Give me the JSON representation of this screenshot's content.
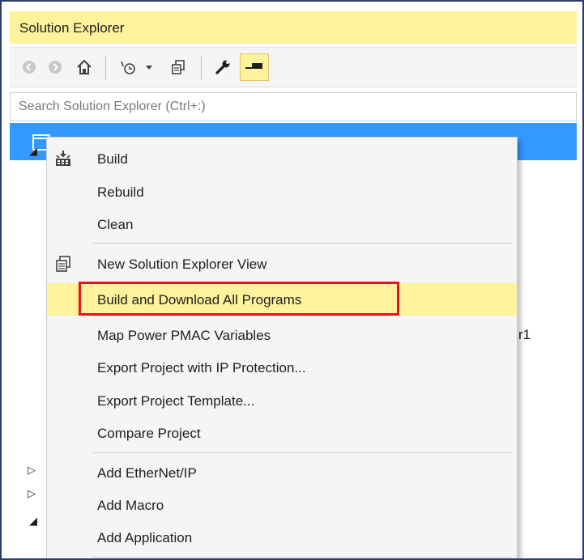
{
  "window": {
    "title": "Solution Explorer"
  },
  "search": {
    "placeholder": "Search Solution Explorer (Ctrl+:)"
  },
  "toolbar": {
    "icons": [
      "back-icon",
      "forward-icon",
      "home-icon",
      "pending-changes-icon",
      "dropdown-arrow-icon",
      "new-view-icon",
      "properties-wrench-icon",
      "pin-icon"
    ]
  },
  "tree": {
    "partial_text": "r1"
  },
  "context_menu": {
    "items": [
      {
        "label": "Build",
        "icon": "build-icon"
      },
      {
        "label": "Rebuild"
      },
      {
        "label": "Clean"
      },
      {
        "label": "New Solution Explorer View",
        "icon": "new-view-icon"
      },
      {
        "label": "Build and Download All Programs",
        "highlighted": true
      },
      {
        "label": "Map Power PMAC Variables"
      },
      {
        "label": "Export Project with IP Protection..."
      },
      {
        "label": "Export Project Template..."
      },
      {
        "label": "Compare Project"
      },
      {
        "label": "Add EtherNet/IP"
      },
      {
        "label": "Add Macro"
      },
      {
        "label": "Add Application"
      }
    ]
  },
  "colors": {
    "accent_yellow": "#fff29d",
    "selection_blue": "#3399ff",
    "annotation_red": "#e8141b",
    "window_border": "#2b3d6b"
  }
}
